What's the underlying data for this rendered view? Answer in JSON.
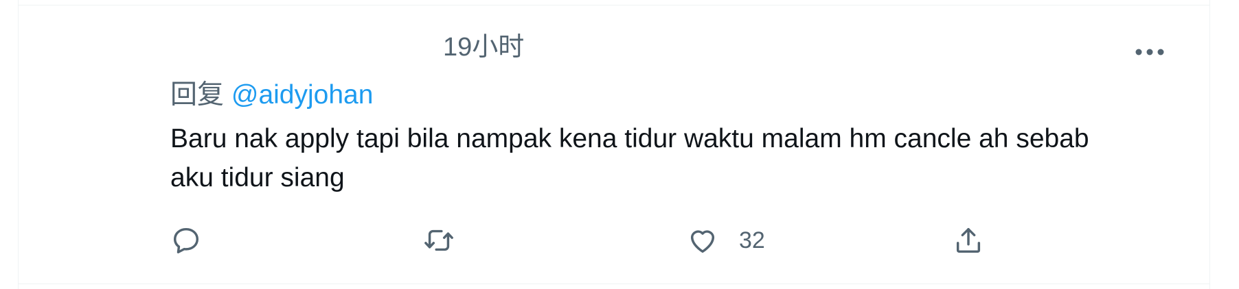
{
  "tweet": {
    "timestamp": "19小时",
    "replying_prefix": "回复",
    "replying_handle": "@aidyjohan",
    "text": "Baru nak apply tapi bila nampak kena tidur waktu malam hm cancle ah sebab aku tidur siang",
    "actions": {
      "reply_icon": "reply-icon",
      "retweet_icon": "retweet-icon",
      "like_icon": "like-icon",
      "like_count": "32",
      "share_icon": "share-icon"
    }
  },
  "colors": {
    "text_primary": "#0f1419",
    "text_secondary": "#536471",
    "link": "#1d9bf0",
    "border": "#eff3f4"
  }
}
